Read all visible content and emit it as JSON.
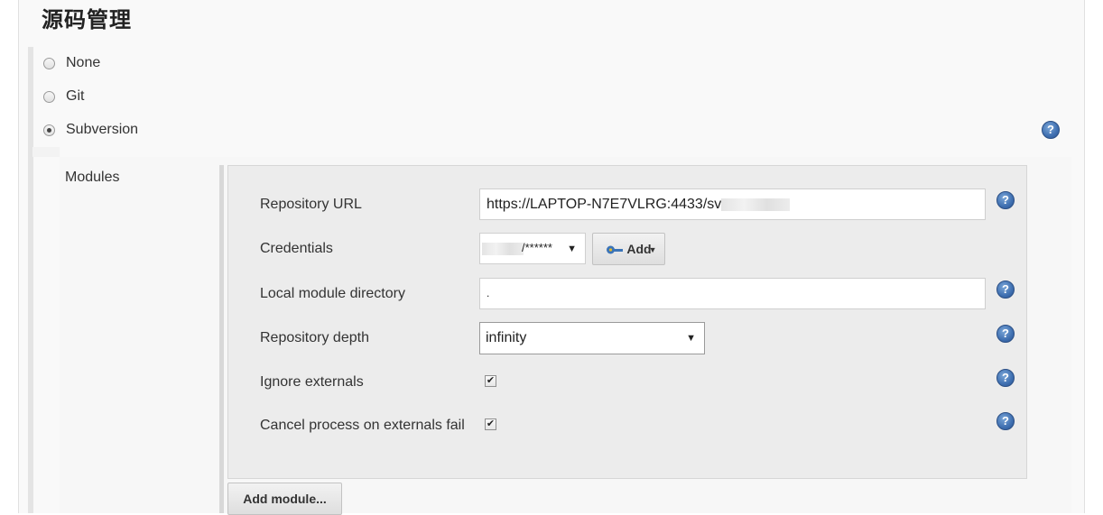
{
  "section": {
    "title": "源码管理"
  },
  "scm_options": [
    {
      "label": "None",
      "checked": false
    },
    {
      "label": "Git",
      "checked": false
    },
    {
      "label": "Subversion",
      "checked": true
    }
  ],
  "help_glyph": "?",
  "modules": {
    "label": "Modules",
    "repository_url": {
      "label": "Repository URL",
      "value": "https://LAPTOP-N7E7VLRG:4433/sv"
    },
    "credentials": {
      "label": "Credentials",
      "selected": "/******",
      "add_label": "Add"
    },
    "local_module_directory": {
      "label": "Local module directory",
      "value": "."
    },
    "repository_depth": {
      "label": "Repository depth",
      "selected": "infinity"
    },
    "ignore_externals": {
      "label": "Ignore externals",
      "checked": true
    },
    "cancel_process": {
      "label": "Cancel process on externals fail",
      "checked": true
    },
    "add_module_label": "Add module..."
  },
  "icons": {
    "help": "help-icon",
    "key": "key-icon",
    "dropdown": "chevron-down-icon",
    "check": "checkmark-icon"
  },
  "colors": {
    "help_blue": "#3f6fb0",
    "key_blue": "#3b74b8",
    "key_yellow": "#e5b82b"
  }
}
